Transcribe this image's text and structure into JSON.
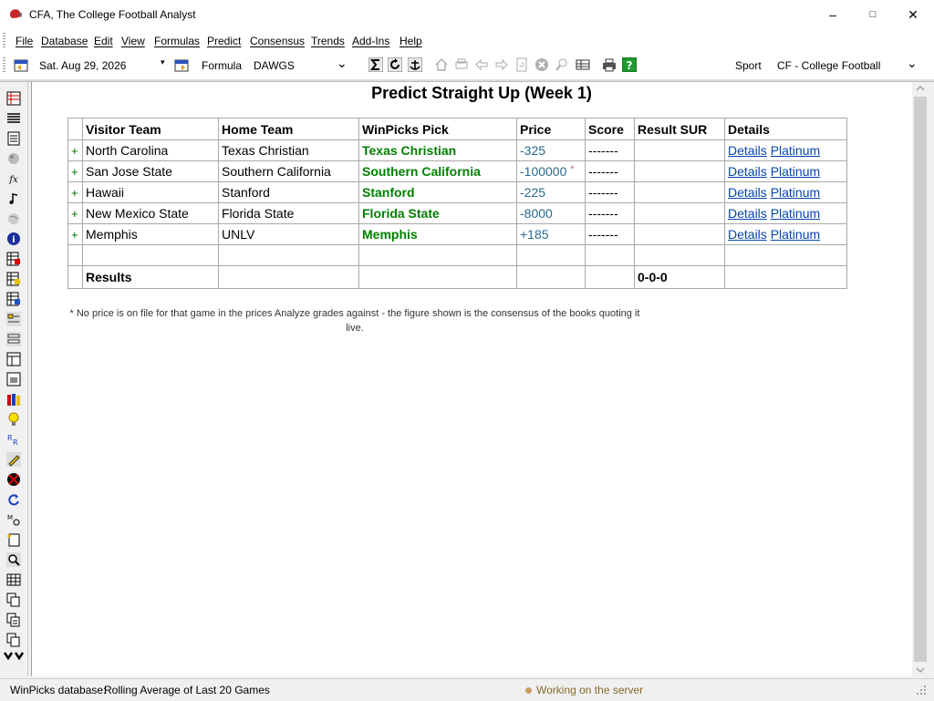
{
  "window": {
    "title": "CFA, The College Football Analyst",
    "controls": {
      "minimize": "–",
      "maximize": "□",
      "close": "✕"
    }
  },
  "menu": [
    "File",
    "Database",
    "Edit",
    "View",
    "Formulas",
    "Predict",
    "Consensus",
    "Trends",
    "Add-Ins",
    "Help"
  ],
  "toolbar": {
    "date": "Sat. Aug 29, 2026",
    "formula_label": "Formula",
    "formula_value": "DAWGS",
    "sport_label": "Sport",
    "sport_value": "CF - College Football"
  },
  "page": {
    "title": "Predict Straight Up (Week 1)",
    "columns": [
      "Visitor Team",
      "Home Team",
      "WinPicks Pick",
      "Price",
      "Score",
      "Result SUR",
      "Details"
    ],
    "rows": [
      {
        "expand": "+",
        "visitor": "North Carolina",
        "home": "Texas Christian",
        "pick": "Texas Christian",
        "price": "-325",
        "price_note": "",
        "score": "-------",
        "result": "",
        "details": "Details",
        "platinum": "Platinum"
      },
      {
        "expand": "+",
        "visitor": "San Jose State",
        "home": "Southern California",
        "pick": "Southern California",
        "price": "-100000",
        "price_note": "*",
        "score": "-------",
        "result": "",
        "details": "Details",
        "platinum": "Platinum"
      },
      {
        "expand": "+",
        "visitor": "Hawaii",
        "home": "Stanford",
        "pick": "Stanford",
        "price": "-225",
        "price_note": "",
        "score": "-------",
        "result": "",
        "details": "Details",
        "platinum": "Platinum"
      },
      {
        "expand": "+",
        "visitor": "New Mexico State",
        "home": "Florida State",
        "pick": "Florida State",
        "price": "-8000",
        "price_note": "",
        "score": "-------",
        "result": "",
        "details": "Details",
        "platinum": "Platinum"
      },
      {
        "expand": "+",
        "visitor": "Memphis",
        "home": "UNLV",
        "pick": "Memphis",
        "price": "+185",
        "price_note": "",
        "score": "-------",
        "result": "",
        "details": "Details",
        "platinum": "Platinum"
      }
    ],
    "results_label": "Results",
    "results_value": "0-0-0",
    "footnote": "* No price is on file for that game in the prices Analyze grades against - the figure shown is the consensus of the books quoting it live."
  },
  "status": {
    "database_label": "WinPicks database:",
    "database_value": "Rolling Average of Last 20 Games",
    "server_status": "Working on the server"
  },
  "colors": {
    "pick": "#008000",
    "price": "#2a6a8c",
    "link": "#0645ad",
    "status_dot": "#c8a060"
  }
}
